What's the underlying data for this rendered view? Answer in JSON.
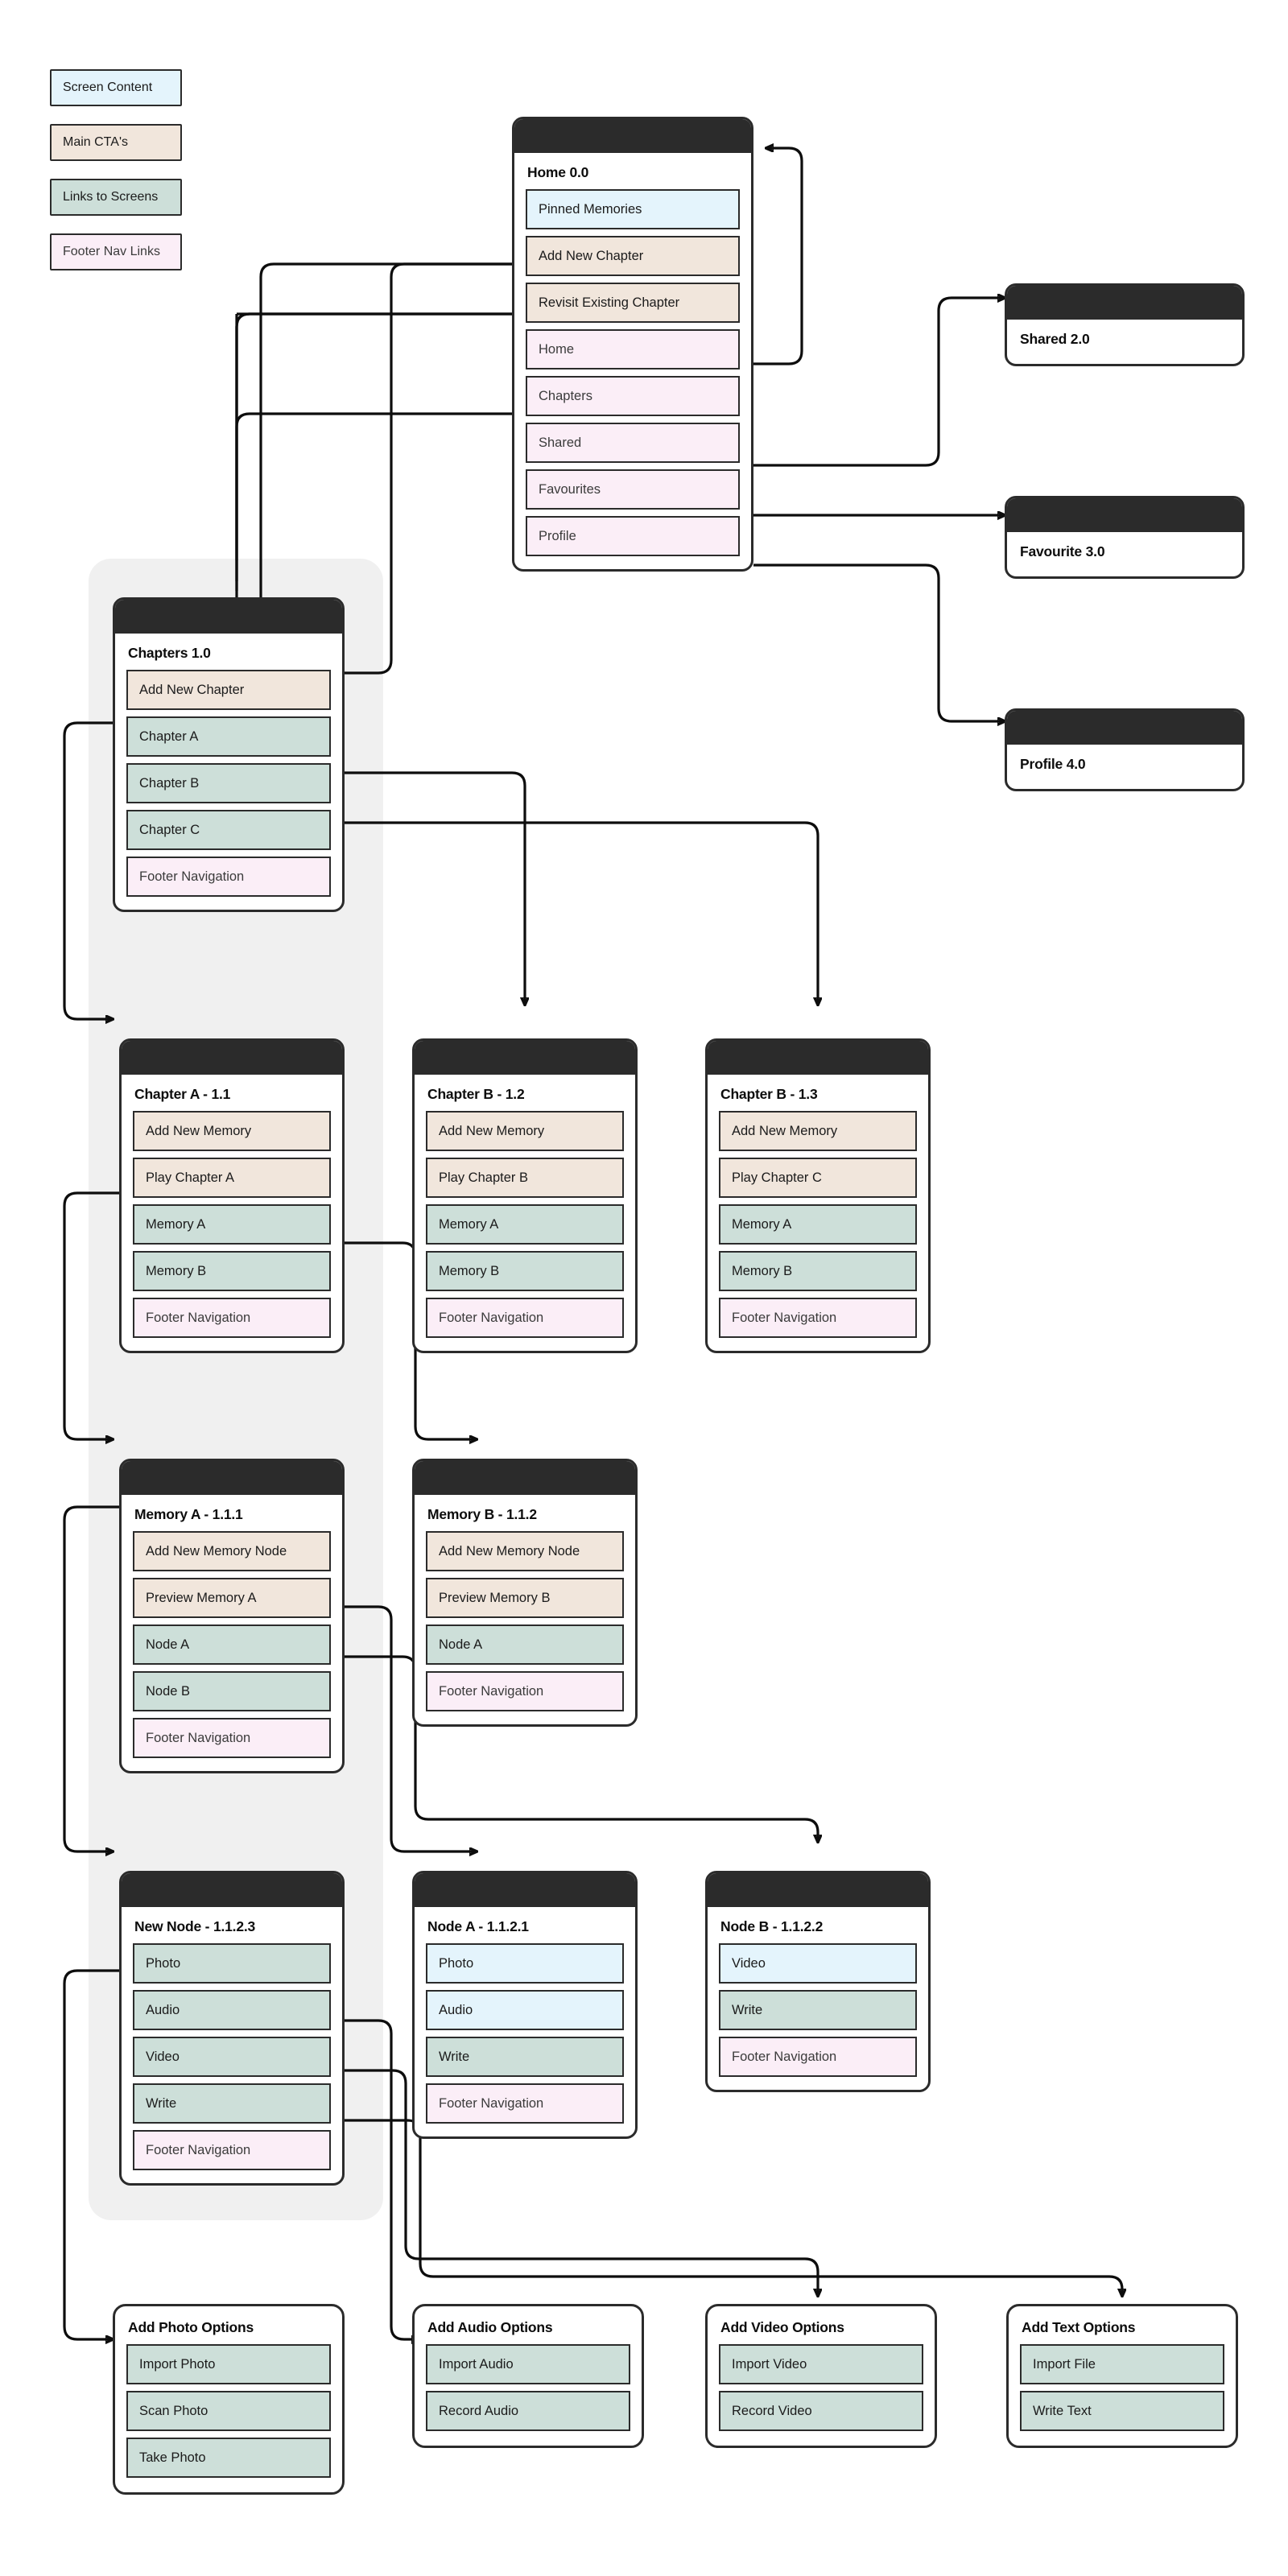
{
  "legend": {
    "items": [
      {
        "label": "Screen Content",
        "kind": "content"
      },
      {
        "label": "Main CTA's",
        "kind": "cta"
      },
      {
        "label": "Links to Screens",
        "kind": "link"
      },
      {
        "label": "Footer Nav Links",
        "kind": "footer"
      }
    ]
  },
  "palette": {
    "screen_content": "#e4f4fc",
    "main_cta": "#f1e6dc",
    "links_to_screens": "#cddfd9",
    "footer_nav": "#fbeef7",
    "card_header": "#2b2b2b",
    "backdrop": "#f0f0f0",
    "stroke": "#0d0d0d"
  },
  "cards": {
    "home": {
      "title": "Home 0.0",
      "rows": [
        {
          "label": "Pinned Memories",
          "kind": "content"
        },
        {
          "label": "Add New Chapter",
          "kind": "cta"
        },
        {
          "label": "Revisit Existing Chapter",
          "kind": "cta"
        },
        {
          "label": "Home",
          "kind": "footer"
        },
        {
          "label": "Chapters",
          "kind": "footer"
        },
        {
          "label": "Shared",
          "kind": "footer"
        },
        {
          "label": "Favourites",
          "kind": "footer"
        },
        {
          "label": "Profile",
          "kind": "footer"
        }
      ]
    },
    "shared": {
      "title": "Shared 2.0",
      "rows": []
    },
    "favourite": {
      "title": "Favourite 3.0",
      "rows": []
    },
    "profile": {
      "title": "Profile 4.0",
      "rows": []
    },
    "chapters": {
      "title": "Chapters 1.0",
      "rows": [
        {
          "label": "Add New Chapter",
          "kind": "cta"
        },
        {
          "label": "Chapter A",
          "kind": "link"
        },
        {
          "label": "Chapter B",
          "kind": "link"
        },
        {
          "label": "Chapter C",
          "kind": "link"
        },
        {
          "label": "Footer Navigation",
          "kind": "footer"
        }
      ]
    },
    "chapter_a": {
      "title": "Chapter A - 1.1",
      "rows": [
        {
          "label": "Add New Memory",
          "kind": "cta"
        },
        {
          "label": "Play Chapter A",
          "kind": "cta"
        },
        {
          "label": "Memory A",
          "kind": "link"
        },
        {
          "label": "Memory B",
          "kind": "link"
        },
        {
          "label": "Footer Navigation",
          "kind": "footer"
        }
      ]
    },
    "chapter_b": {
      "title": "Chapter B - 1.2",
      "rows": [
        {
          "label": "Add New Memory",
          "kind": "cta"
        },
        {
          "label": "Play Chapter B",
          "kind": "cta"
        },
        {
          "label": "Memory A",
          "kind": "link"
        },
        {
          "label": "Memory B",
          "kind": "link"
        },
        {
          "label": "Footer Navigation",
          "kind": "footer"
        }
      ]
    },
    "chapter_c": {
      "title": "Chapter B - 1.3",
      "rows": [
        {
          "label": "Add New Memory",
          "kind": "cta"
        },
        {
          "label": "Play Chapter C",
          "kind": "cta"
        },
        {
          "label": "Memory A",
          "kind": "link"
        },
        {
          "label": "Memory B",
          "kind": "link"
        },
        {
          "label": "Footer Navigation",
          "kind": "footer"
        }
      ]
    },
    "memory_a": {
      "title": "Memory A - 1.1.1",
      "rows": [
        {
          "label": "Add New Memory Node",
          "kind": "cta"
        },
        {
          "label": "Preview Memory A",
          "kind": "cta"
        },
        {
          "label": "Node A",
          "kind": "link"
        },
        {
          "label": "Node B",
          "kind": "link"
        },
        {
          "label": "Footer Navigation",
          "kind": "footer"
        }
      ]
    },
    "memory_b": {
      "title": "Memory B - 1.1.2",
      "rows": [
        {
          "label": "Add New Memory Node",
          "kind": "cta"
        },
        {
          "label": "Preview Memory B",
          "kind": "cta"
        },
        {
          "label": "Node A",
          "kind": "link"
        },
        {
          "label": "Footer Navigation",
          "kind": "footer"
        }
      ]
    },
    "new_node": {
      "title": "New Node - 1.1.2.3",
      "rows": [
        {
          "label": "Photo",
          "kind": "link"
        },
        {
          "label": "Audio",
          "kind": "link"
        },
        {
          "label": "Video",
          "kind": "link"
        },
        {
          "label": "Write",
          "kind": "link"
        },
        {
          "label": "Footer Navigation",
          "kind": "footer"
        }
      ]
    },
    "node_a": {
      "title": "Node A - 1.1.2.1",
      "rows": [
        {
          "label": "Photo",
          "kind": "content"
        },
        {
          "label": "Audio",
          "kind": "content"
        },
        {
          "label": "Write",
          "kind": "link"
        },
        {
          "label": "Footer Navigation",
          "kind": "footer"
        }
      ]
    },
    "node_b": {
      "title": "Node B - 1.1.2.2",
      "rows": [
        {
          "label": "Video",
          "kind": "content"
        },
        {
          "label": "Write",
          "kind": "link"
        },
        {
          "label": "Footer Navigation",
          "kind": "footer"
        }
      ]
    },
    "add_photo": {
      "title": "Add Photo Options",
      "rows": [
        {
          "label": "Import Photo",
          "kind": "link"
        },
        {
          "label": "Scan Photo",
          "kind": "link"
        },
        {
          "label": "Take Photo",
          "kind": "link"
        }
      ]
    },
    "add_audio": {
      "title": "Add Audio Options",
      "rows": [
        {
          "label": "Import Audio",
          "kind": "link"
        },
        {
          "label": "Record Audio",
          "kind": "link"
        }
      ]
    },
    "add_video": {
      "title": "Add Video Options",
      "rows": [
        {
          "label": "Import Video",
          "kind": "link"
        },
        {
          "label": "Record Video",
          "kind": "link"
        }
      ]
    },
    "add_text": {
      "title": "Add Text Options",
      "rows": [
        {
          "label": "Import File",
          "kind": "link"
        },
        {
          "label": "Write Text",
          "kind": "link"
        }
      ]
    }
  }
}
